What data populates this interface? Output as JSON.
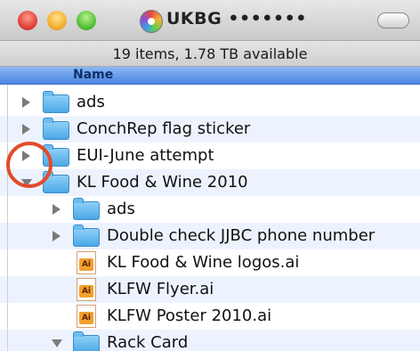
{
  "window": {
    "title": "UKBG •••••••",
    "status": "19 items, 1.78 TB available",
    "column_header": "Name"
  },
  "icons": {
    "close": "close-traffic-light-icon",
    "minimize": "minimize-traffic-light-icon",
    "zoom": "zoom-traffic-light-icon",
    "disk": "disk-icon",
    "folder": "folder-icon",
    "illustrator": "illustrator-file-icon"
  },
  "colors": {
    "header_blue": "#4a86e0",
    "stripe": "#edf3fe",
    "annotation_red": "#e24b2b"
  },
  "files": [
    {
      "label": "ads"
    },
    {
      "label": "ConchRep flag sticker"
    },
    {
      "label": "EUI-June attempt"
    },
    {
      "label": "KL Food & Wine 2010"
    },
    {
      "label": "ads"
    },
    {
      "label": "Double check JJBC phone number"
    },
    {
      "label": "KL Food & Wine logos.ai"
    },
    {
      "label": "KLFW Flyer.ai"
    },
    {
      "label": "KLFW Poster 2010.ai"
    },
    {
      "label": "Rack Card"
    }
  ]
}
